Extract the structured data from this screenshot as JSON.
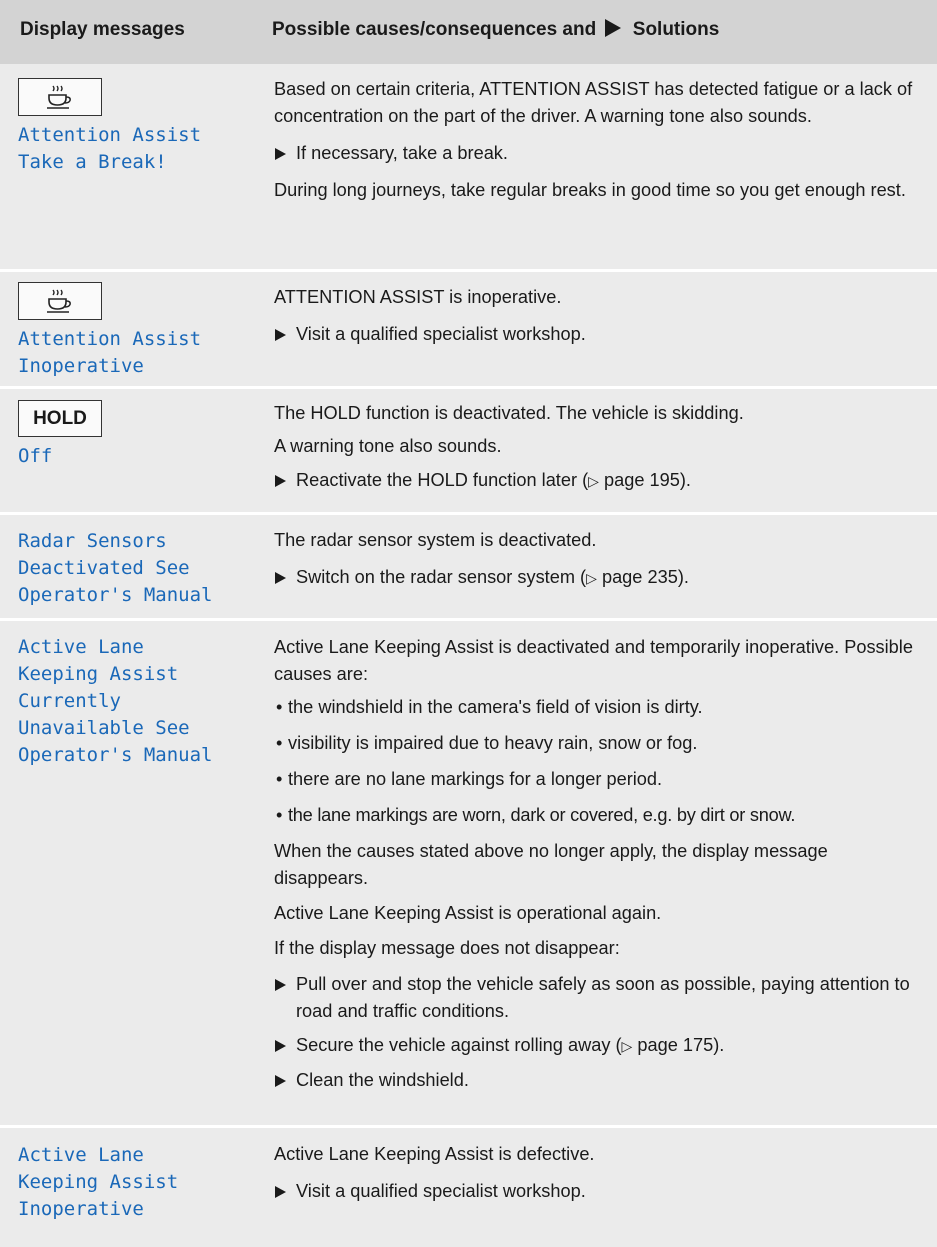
{
  "header": {
    "col1": "Display messages",
    "col2_pre": "Possible causes/consequences and",
    "col2_post": "Solutions"
  },
  "icons": {
    "coffee_cup": "coffee-cup-icon",
    "action_arrow": "triangle-right-icon",
    "page_ref": "triangle-outline-icon"
  },
  "rows": [
    {
      "message": "Attention Assist\nTake a Break!",
      "p1": "Based on certain criteria, ATTENTION ASSIST has detected fatigue or a lack of concentration on the part of the driver. A warning tone also sounds.",
      "a1": "If necessary, take a break.",
      "p2": "During long journeys, take regular breaks in good time so you get enough rest."
    },
    {
      "message": "Attention Assist\nInoperative",
      "p1": "ATTENTION ASSIST is inoperative.",
      "a1": "Visit a qualified specialist workshop."
    },
    {
      "badge": "HOLD",
      "message": "Off",
      "p1": "The HOLD function is deactivated. The vehicle is skidding.",
      "p2": "A warning tone also sounds.",
      "a1": "Reactivate the HOLD function later (",
      "a1_page": "page 195",
      "a1_end": ")."
    },
    {
      "message": "Radar Sensors\nDeactivated See\nOperator's Manual",
      "p1": "The radar sensor system is deactivated.",
      "a1": "Switch on the radar sensor system (",
      "a1_page": "page 235",
      "a1_end": ")."
    },
    {
      "message": "Active Lane\nKeeping Assist\nCurrently\nUnavailable See\nOperator's Manual",
      "p1": "Active Lane Keeping Assist is deactivated and temporarily inoperative. Possible causes are:",
      "bullets": [
        "the windshield in the camera's field of vision is dirty.",
        "visibility is impaired due to heavy rain, snow or fog.",
        "there are no lane markings for a longer period.",
        "the lane markings are worn, dark or covered, e.g. by dirt or snow."
      ],
      "p2": "When the causes stated above no longer apply, the display message disappears.",
      "p3": "Active Lane Keeping Assist is operational again.",
      "p4": "If the display message does not disappear:",
      "a1": "Pull over and stop the vehicle safely as soon as possible, paying attention to road and traffic conditions.",
      "a2": "Secure the vehicle against rolling away (",
      "a2_page": "page 175",
      "a2_end": ").",
      "a3": "Clean the windshield."
    },
    {
      "message": "Active Lane\nKeeping Assist\nInoperative",
      "p1": "Active Lane Keeping Assist is defective.",
      "a1": "Visit a qualified specialist workshop."
    }
  ]
}
